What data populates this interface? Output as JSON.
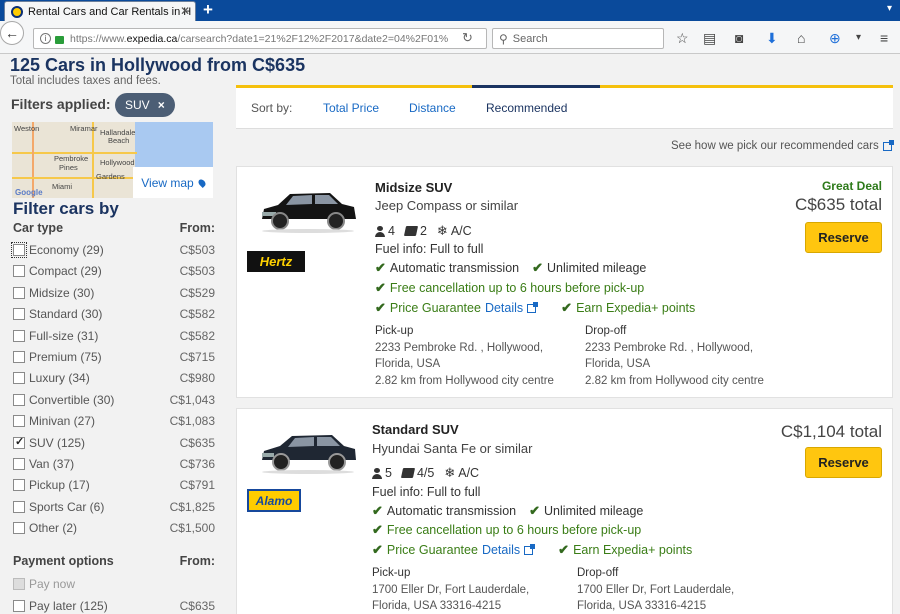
{
  "browser": {
    "tab_title": "Rental Cars and Car Rentals in H",
    "url_prefix": "https://www.",
    "url_host": "expedia.ca",
    "url_path": "/carsearch?date1=21%2F12%2F2017&date2=04%2F01%",
    "search_placeholder": "Search"
  },
  "header": {
    "title": "125 Cars in Hollywood from C$635",
    "subtitle": "Total includes taxes and fees.",
    "filters_label": "Filters applied:",
    "chip_label": "SUV",
    "chip_close": "×"
  },
  "map": {
    "view_map": "View map",
    "labels": [
      "Weston",
      "Pembroke",
      "Pines",
      "Hollywood",
      "Hallandale",
      "Beach",
      "Miami",
      "Gardens",
      "Miramar"
    ],
    "google": "Google"
  },
  "filters": {
    "heading": "Filter cars by",
    "car_type_label": "Car type",
    "from_label": "From:",
    "car_types": [
      {
        "label": "Economy (29)",
        "price": "C$503",
        "checked": false
      },
      {
        "label": "Compact (29)",
        "price": "C$503",
        "checked": false
      },
      {
        "label": "Midsize (30)",
        "price": "C$529",
        "checked": false
      },
      {
        "label": "Standard (30)",
        "price": "C$582",
        "checked": false
      },
      {
        "label": "Full-size (31)",
        "price": "C$582",
        "checked": false
      },
      {
        "label": "Premium (75)",
        "price": "C$715",
        "checked": false
      },
      {
        "label": "Luxury (34)",
        "price": "C$980",
        "checked": false
      },
      {
        "label": "Convertible (30)",
        "price": "C$1,043",
        "checked": false
      },
      {
        "label": "Minivan (27)",
        "price": "C$1,083",
        "checked": false
      },
      {
        "label": "SUV (125)",
        "price": "C$635",
        "checked": true
      },
      {
        "label": "Van (37)",
        "price": "C$736",
        "checked": false
      },
      {
        "label": "Pickup (17)",
        "price": "C$791",
        "checked": false
      },
      {
        "label": "Sports Car (6)",
        "price": "C$1,825",
        "checked": false
      },
      {
        "label": "Other (2)",
        "price": "C$1,500",
        "checked": false
      }
    ],
    "payment_label": "Payment options",
    "payment_from": "From:",
    "payment": [
      {
        "label": "Pay now",
        "price": ""
      },
      {
        "label": "Pay later (125)",
        "price": "C$635"
      }
    ]
  },
  "sort": {
    "label": "Sort by:",
    "options": [
      "Total Price",
      "Distance",
      "Recommended"
    ],
    "active": "Recommended"
  },
  "recommend_link": "See how we pick our recommended cars",
  "cars": [
    {
      "title": "Midsize SUV",
      "model": "Jeep Compass or similar",
      "passengers": "4",
      "bags": "2",
      "ac": "A/C",
      "fuel": "Fuel info: Full to full",
      "transmission": "Automatic transmission",
      "mileage": "Unlimited mileage",
      "cancellation": "Free cancellation up to 6 hours before pick-up",
      "guarantee": "Price Guarantee",
      "details": "Details",
      "points": "Earn Expedia+ points",
      "pickup_label": "Pick-up",
      "pickup_lines": [
        "2233 Pembroke Rd. , Hollywood,",
        "Florida, USA",
        "2.82 km from Hollywood city centre"
      ],
      "dropoff_label": "Drop-off",
      "dropoff_lines": [
        "2233 Pembroke Rd. , Hollywood,",
        "Florida, USA",
        "2.82 km from Hollywood city centre"
      ],
      "deal": "Great Deal",
      "total": "C$635 total",
      "reserve": "Reserve",
      "brand": "Hertz",
      "car_color": "#111111"
    },
    {
      "title": "Standard SUV",
      "model": "Hyundai Santa Fe or similar",
      "passengers": "5",
      "bags": "4/5",
      "ac": "A/C",
      "fuel": "Fuel info: Full to full",
      "transmission": "Automatic transmission",
      "mileage": "Unlimited mileage",
      "cancellation": "Free cancellation up to 6 hours before pick-up",
      "guarantee": "Price Guarantee",
      "details": "Details",
      "points": "Earn Expedia+ points",
      "pickup_label": "Pick-up",
      "pickup_lines": [
        "1700 Eller Dr, Fort Lauderdale,",
        "Florida, USA 33316-4215"
      ],
      "dropoff_label": "Drop-off",
      "dropoff_lines": [
        "1700 Eller Dr, Fort Lauderdale,",
        "Florida, USA 33316-4215"
      ],
      "deal": "",
      "total": "C$1,104 total",
      "reserve": "Reserve",
      "brand": "Alamo",
      "car_color": "#1c2330"
    }
  ]
}
